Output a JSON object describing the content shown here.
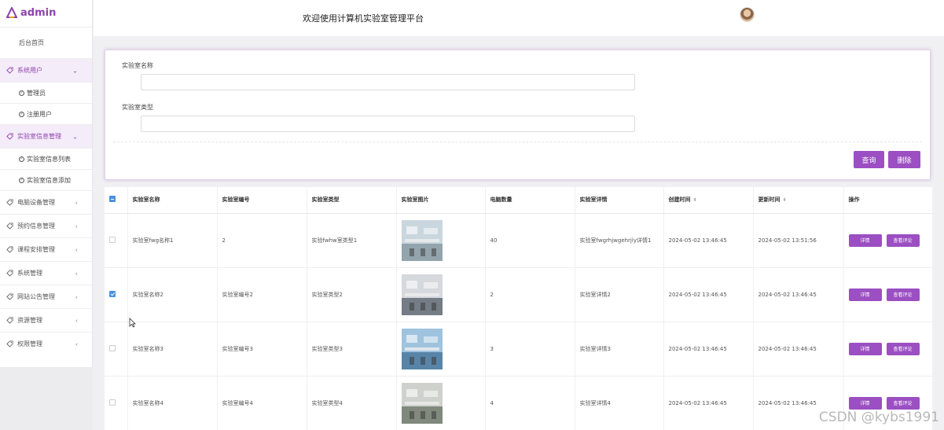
{
  "app": {
    "logo_text": "admin",
    "header_title": "欢迎使用计算机实验室管理平台"
  },
  "sidebar": {
    "home": "后台首页",
    "items": [
      {
        "label": "系统用户",
        "open": true,
        "children": [
          "管理员",
          "注册用户"
        ]
      },
      {
        "label": "实验室信息管理",
        "open": true,
        "children": [
          "实验室信息列表",
          "实验室信息添加"
        ]
      },
      {
        "label": "电脑设备管理"
      },
      {
        "label": "预约信息管理"
      },
      {
        "label": "课程安排管理"
      },
      {
        "label": "系统管理"
      },
      {
        "label": "网站公告管理"
      },
      {
        "label": "资源管理"
      },
      {
        "label": "权限管理"
      }
    ]
  },
  "search": {
    "name_label": "实验室名称",
    "name_value": "",
    "type_label": "实验室类型",
    "type_value": "",
    "query_button": "查询",
    "delete_button": "删除"
  },
  "table": {
    "headers": [
      "实验室名称",
      "实验室编号",
      "实验室类型",
      "实验室图片",
      "电脑数量",
      "实验室详情",
      "创建时间",
      "更新时间",
      "操作"
    ],
    "rows": [
      {
        "checked": false,
        "name": "实验室fwg名称1",
        "code": "2",
        "type": "实验fwhw室类型1",
        "computers": "40",
        "detail": "实验室fwgrhjwgehrjly详情1",
        "created": "2024-05-02 13:46:45",
        "updated": "2024-05-02 13:51:56",
        "photo_colors": [
          "#c9d6de",
          "#7e8f99"
        ]
      },
      {
        "checked": true,
        "name": "实验室名称2",
        "code": "实验室编号2",
        "type": "实验室类型2",
        "computers": "2",
        "detail": "实验室详情2",
        "created": "2024-05-02 13:46:45",
        "updated": "2024-05-02 13:46:45",
        "photo_colors": [
          "#d5d8dc",
          "#4a5560"
        ]
      },
      {
        "checked": false,
        "name": "实验室名称3",
        "code": "实验室编号3",
        "type": "实验室类型3",
        "computers": "3",
        "detail": "实验室详情3",
        "created": "2024-05-02 13:46:45",
        "updated": "2024-05-02 13:46:45",
        "photo_colors": [
          "#9fc3df",
          "#3b6a8f"
        ]
      },
      {
        "checked": false,
        "name": "实验室名称4",
        "code": "实验室编号4",
        "type": "实验室类型4",
        "computers": "4",
        "detail": "实验室详情4",
        "created": "2024-05-02 13:46:45",
        "updated": "2024-05-02 13:46:45",
        "photo_colors": [
          "#cfd2cc",
          "#5e6a5a"
        ]
      }
    ],
    "detail_button": "详情",
    "review_button": "查看评论"
  },
  "watermark": "CSDN @kybs1991",
  "colors": {
    "accent": "#9b4fc2",
    "checkbox": "#4a90e2"
  }
}
